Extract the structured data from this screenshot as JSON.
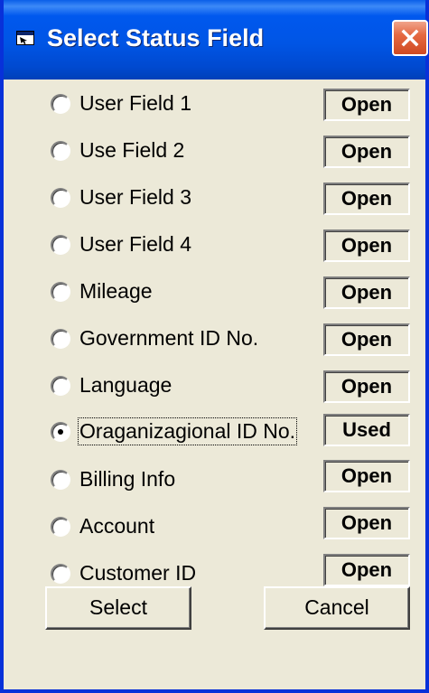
{
  "window": {
    "title": "Select Status Field",
    "accent_color": "#0058ee",
    "close_icon": "close-icon"
  },
  "options": [
    {
      "label": "User Field 1",
      "status": "Open",
      "selected": false
    },
    {
      "label": "Use Field 2",
      "status": "Open",
      "selected": false
    },
    {
      "label": "User Field 3",
      "status": "Open",
      "selected": false
    },
    {
      "label": "User Field 4",
      "status": "Open",
      "selected": false
    },
    {
      "label": "Mileage",
      "status": "Open",
      "selected": false
    },
    {
      "label": "Government ID No.",
      "status": "Open",
      "selected": false
    },
    {
      "label": "Language",
      "status": "Open",
      "selected": false
    },
    {
      "label": "Oraganizagional ID No.",
      "status": "Used",
      "selected": true
    },
    {
      "label": "Billing Info",
      "status": "Open",
      "selected": false
    },
    {
      "label": "Account",
      "status": "Open",
      "selected": false
    },
    {
      "label": "Customer ID",
      "status": "Open",
      "selected": false
    }
  ],
  "buttons": {
    "select_label": "Select",
    "cancel_label": "Cancel"
  }
}
